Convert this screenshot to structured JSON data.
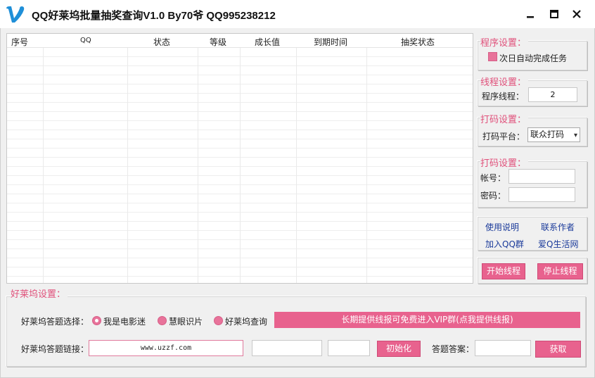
{
  "window": {
    "title": "QQ好莱坞批量抽奖查询V1.0 By70爷 QQ995238212"
  },
  "table": {
    "columns": [
      "序号",
      "QQ",
      "状态",
      "等级",
      "成长值",
      "到期时间",
      "抽奖状态"
    ],
    "rows": []
  },
  "program_settings": {
    "legend": "程序设置：",
    "auto_task_label": "次日自动完成任务"
  },
  "thread_settings": {
    "legend": "线程设置：",
    "threads_label": "程序线程：",
    "threads_value": "2"
  },
  "captcha_platform": {
    "legend": "打码设置：",
    "platform_label": "打码平台：",
    "platform_selected": "联众打码"
  },
  "captcha_account": {
    "legend": "打码设置：",
    "account_label": "帐号：",
    "password_label": "密码：",
    "account_value": "",
    "password_value": ""
  },
  "links": {
    "usage": "使用说明",
    "contact": "联系作者",
    "join_group": "加入QQ群",
    "ai_life": "爱Q生活网"
  },
  "thread_controls": {
    "start": "开始线程",
    "stop": "停止线程"
  },
  "hollywood": {
    "legend": "好莱坞设置：",
    "answer_choice_label": "好莱坞答题选择：",
    "options": [
      "我是电影迷",
      "慧眼识片",
      "好莱坞查询"
    ],
    "selected_option": 0,
    "banner_text": "长期提供线报可免费进入VIP群(点我提供线报)",
    "link_label": "好莱坞答题链接：",
    "link_value": "www.uzzf.com",
    "extra_field_1": "",
    "extra_field_2": "",
    "init_button": "初始化",
    "answer_label": "答题答案：",
    "answer_value": "",
    "fetch_button": "获取"
  },
  "colors": {
    "accent": "#e8628e",
    "legend_text": "#e0517b",
    "link_text": "#1a3a9a"
  }
}
